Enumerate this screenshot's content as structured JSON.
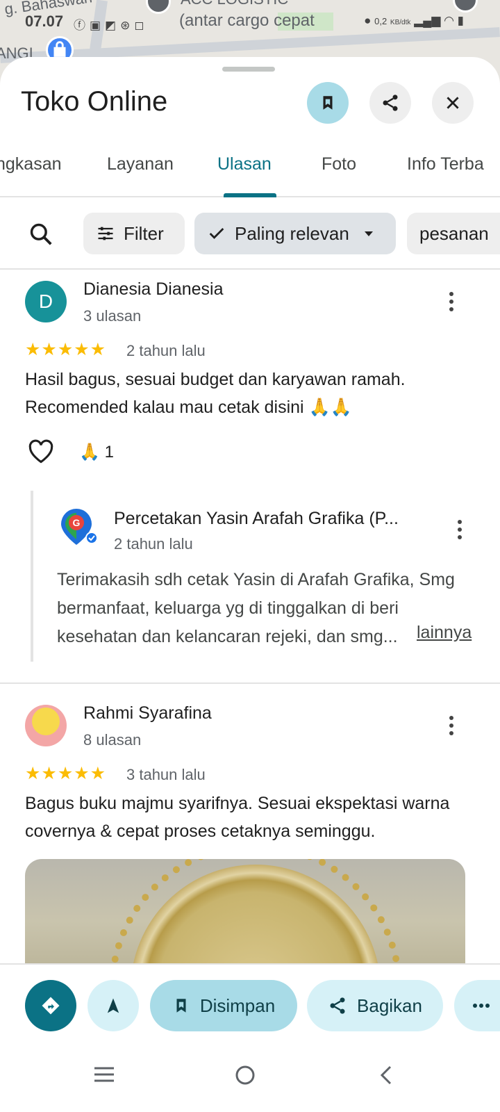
{
  "map": {
    "label_top_left": "g. Bahaswan",
    "label_top": "ACC LOGISTIC",
    "label_left": "ANGI"
  },
  "status_bar": {
    "time": "07.07",
    "notification": "(antar cargo cepat",
    "net_speed": "0,2",
    "net_unit": "KB/dtk"
  },
  "header": {
    "title": "Toko Online"
  },
  "tabs": [
    {
      "label": "ngkasan"
    },
    {
      "label": "Layanan"
    },
    {
      "label": "Ulasan"
    },
    {
      "label": "Foto"
    },
    {
      "label": "Info Terba"
    }
  ],
  "filters": {
    "filter_label": "Filter",
    "sort_label": "Paling relevan",
    "keyword_chip": "pesanan"
  },
  "reviews": [
    {
      "avatar_letter": "D",
      "name": "Dianesia Dianesia",
      "count": "3 ulasan",
      "stars": "★★★★★",
      "time": "2 tahun lalu",
      "text": "Hasil bagus, sesuai budget dan karyawan ramah. Recomended kalau mau cetak disini 🙏🙏",
      "reaction_emoji": "🙏",
      "reaction_count": "1",
      "reply": {
        "owner": "Percetakan Yasin Arafah Grafika (P...",
        "time": "2 tahun lalu",
        "text": "Terimakasih sdh cetak Yasin di Arafah Grafika, Smg bermanfaat, keluarga yg di tinggalkan di beri kesehatan dan kelancaran rejeki, dan smg...",
        "more_label": "lainnya"
      }
    },
    {
      "name": "Rahmi Syarafina",
      "count": "8 ulasan",
      "stars": "★★★★★",
      "time": "3 tahun lalu",
      "text": "Bagus buku majmu syarifnya. Sesuai ekspektasi warna covernya & cepat proses cetaknya seminggu."
    }
  ],
  "action_bar": {
    "saved_label": "Disimpan",
    "share_label": "Bagikan"
  },
  "colors": {
    "accent": "#0b7285",
    "star": "#fbbc04",
    "saved_bg": "#a8dbe7"
  }
}
